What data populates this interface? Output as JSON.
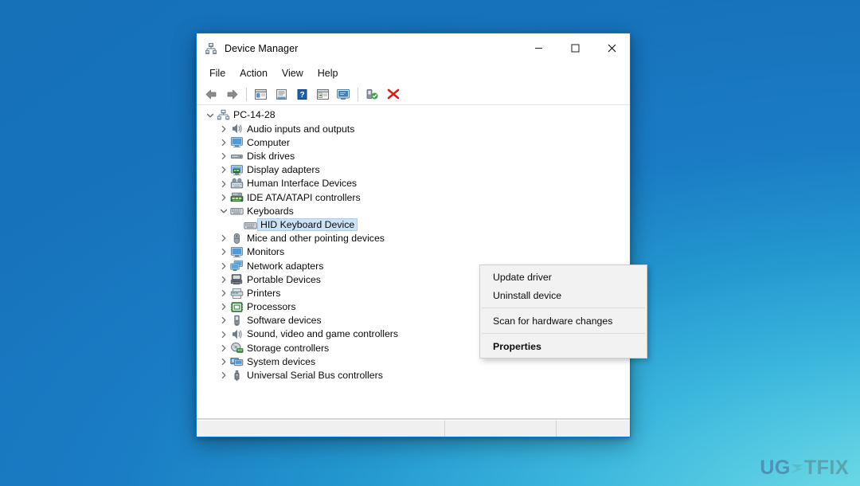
{
  "desktop": {
    "background_top_color": "#1a78c2",
    "background_bottom_color": "#7ee0ea",
    "watermark": {
      "part_a": "UG",
      "part_e": "E",
      "part_b": "TFIX",
      "full": "UGETFIX"
    }
  },
  "window": {
    "title": "Device Manager",
    "title_icon": "device-manager-icon",
    "controls": {
      "minimize": "—",
      "maximize": "☐",
      "close": "✕"
    },
    "menubar": [
      {
        "label": "File",
        "name": "menu-file"
      },
      {
        "label": "Action",
        "name": "menu-action"
      },
      {
        "label": "View",
        "name": "menu-view"
      },
      {
        "label": "Help",
        "name": "menu-help"
      }
    ],
    "toolbar": [
      {
        "name": "back-icon",
        "tooltip": "Back"
      },
      {
        "name": "forward-icon",
        "tooltip": "Forward"
      },
      {
        "name": "separator-1",
        "tooltip": ""
      },
      {
        "name": "show-hide-console-tree-icon",
        "tooltip": "Show/Hide console tree"
      },
      {
        "name": "properties-icon",
        "tooltip": "Properties"
      },
      {
        "name": "help-icon",
        "tooltip": "Help"
      },
      {
        "name": "update-driver-icon",
        "tooltip": "Update driver"
      },
      {
        "name": "scan-for-hardware-changes-icon",
        "tooltip": "Scan for hardware changes"
      },
      {
        "name": "separator-2",
        "tooltip": ""
      },
      {
        "name": "enable-device-icon",
        "tooltip": "Enable device"
      },
      {
        "name": "uninstall-device-icon",
        "tooltip": "Uninstall device"
      }
    ]
  },
  "tree": {
    "root": {
      "label": "PC-14-28",
      "icon": "computer-node-icon",
      "expanded": true,
      "level": 0
    },
    "nodes": [
      {
        "label": "Audio inputs and outputs",
        "icon": "speaker-icon",
        "expanded": false,
        "level": 1
      },
      {
        "label": "Computer",
        "icon": "monitor-icon",
        "expanded": false,
        "level": 1
      },
      {
        "label": "Disk drives",
        "icon": "disk-drive-icon",
        "expanded": false,
        "level": 1
      },
      {
        "label": "Display adapters",
        "icon": "display-adapter-icon",
        "expanded": false,
        "level": 1
      },
      {
        "label": "Human Interface Devices",
        "icon": "hid-icon",
        "expanded": false,
        "level": 1
      },
      {
        "label": "IDE ATA/ATAPI controllers",
        "icon": "ide-controller-icon",
        "expanded": false,
        "level": 1
      },
      {
        "label": "Keyboards",
        "icon": "keyboard-icon",
        "expanded": true,
        "level": 1
      },
      {
        "label": "HID Keyboard Device",
        "icon": "keyboard-device-icon",
        "expanded": null,
        "level": 2,
        "selected": true
      },
      {
        "label": "Mice and other pointing devices",
        "icon": "mouse-icon",
        "expanded": false,
        "level": 1
      },
      {
        "label": "Monitors",
        "icon": "monitor-icon",
        "expanded": false,
        "level": 1
      },
      {
        "label": "Network adapters",
        "icon": "network-adapter-icon",
        "expanded": false,
        "level": 1
      },
      {
        "label": "Portable Devices",
        "icon": "portable-device-icon",
        "expanded": false,
        "level": 1
      },
      {
        "label": "Printers",
        "icon": "printer-icon",
        "expanded": false,
        "level": 1
      },
      {
        "label": "Processors",
        "icon": "processor-icon",
        "expanded": false,
        "level": 1
      },
      {
        "label": "Software devices",
        "icon": "software-device-icon",
        "expanded": false,
        "level": 1
      },
      {
        "label": "Sound, video and game controllers",
        "icon": "sound-controller-icon",
        "expanded": false,
        "level": 1
      },
      {
        "label": "Storage controllers",
        "icon": "storage-controller-icon",
        "expanded": false,
        "level": 1
      },
      {
        "label": "System devices",
        "icon": "system-device-icon",
        "expanded": false,
        "level": 1
      },
      {
        "label": "Universal Serial Bus controllers",
        "icon": "usb-controller-icon",
        "expanded": false,
        "level": 1
      }
    ]
  },
  "context_menu": {
    "items": [
      {
        "label": "Update driver",
        "type": "item",
        "bold": false,
        "name": "ctx-update-driver"
      },
      {
        "label": "Uninstall device",
        "type": "item",
        "bold": false,
        "name": "ctx-uninstall-device"
      },
      {
        "label": "",
        "type": "separator",
        "bold": false,
        "name": "ctx-separator-1"
      },
      {
        "label": "Scan for hardware changes",
        "type": "item",
        "bold": false,
        "name": "ctx-scan-for-hardware-changes"
      },
      {
        "label": "",
        "type": "separator",
        "bold": false,
        "name": "ctx-separator-2"
      },
      {
        "label": "Properties",
        "type": "item",
        "bold": true,
        "name": "ctx-properties"
      }
    ]
  },
  "statusbar": {
    "pane1": "",
    "pane2": "",
    "pane3": ""
  }
}
